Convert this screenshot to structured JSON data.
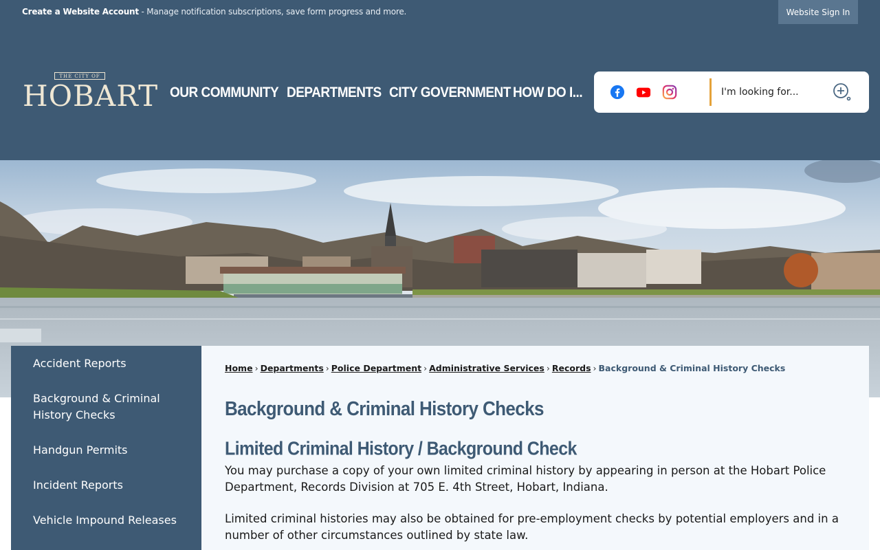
{
  "topbar": {
    "account_strong": "Create a Website Account",
    "account_text": " - Manage notification subscriptions, save form progress and more.",
    "signin_label": "Website Sign In"
  },
  "logo": {
    "small_text": "THE CITY OF",
    "big_text": "HOBART"
  },
  "nav": {
    "items": [
      {
        "label": "OUR COMMUNITY"
      },
      {
        "label": "DEPARTMENTS"
      },
      {
        "label": "CITY GOVERNMENT"
      },
      {
        "label": "HOW DO I..."
      }
    ]
  },
  "search": {
    "placeholder": "I'm looking for...",
    "social": [
      "facebook-icon",
      "youtube-icon",
      "instagram-icon"
    ],
    "accent_color": "#e5a23a"
  },
  "sidebar": {
    "items": [
      {
        "label": "Accident Reports"
      },
      {
        "label": "Background & Criminal History Checks"
      },
      {
        "label": "Handgun Permits"
      },
      {
        "label": "Incident Reports"
      },
      {
        "label": "Vehicle Impound Releases"
      }
    ]
  },
  "breadcrumb": {
    "links": [
      "Home",
      "Departments",
      "Police Department",
      "Administrative Services",
      "Records"
    ],
    "current": "Background & Criminal History Checks"
  },
  "content": {
    "title": "Background & Criminal History Checks",
    "subtitle": "Limited Criminal History / Background Check",
    "paragraphs": [
      "You may purchase a copy of your own limited criminal history by appearing in person at the Hobart Police Department, Records Division at 705 E. 4th Street, Hobart, Indiana.",
      "Limited criminal histories may also be obtained for pre-employment checks by potential employers and in a number of other circumstances outlined by state law."
    ]
  },
  "colors": {
    "brand": "#3e5a74",
    "content_bg": "#f4f8fc",
    "logo_cream": "#efe7d4"
  }
}
